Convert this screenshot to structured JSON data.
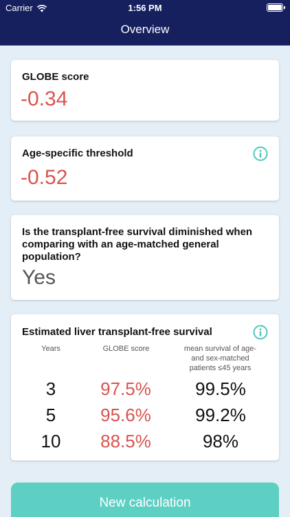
{
  "status_bar": {
    "carrier": "Carrier",
    "time": "1:56 PM"
  },
  "header": {
    "title": "Overview"
  },
  "globe": {
    "label": "GLOBE score",
    "value": "-0.34"
  },
  "threshold": {
    "label": "Age-specific threshold",
    "value": "-0.52",
    "info_icon": "info-icon"
  },
  "comparison": {
    "question": "Is the transplant-free survival diminished when comparing with an age-matched general population?",
    "answer": "Yes"
  },
  "survival": {
    "title": "Estimated liver transplant-free survival",
    "info_icon": "info-icon",
    "headers": {
      "years": "Years",
      "globe": "GLOBE score",
      "mean": "mean survival of age- and sex-matched patients ≤45 years"
    },
    "rows": [
      {
        "years": "3",
        "globe": "97.5%",
        "mean": "99.5%"
      },
      {
        "years": "5",
        "globe": "95.6%",
        "mean": "99.2%"
      },
      {
        "years": "10",
        "globe": "88.5%",
        "mean": "98%"
      }
    ]
  },
  "actions": {
    "new_calculation": "New calculation"
  },
  "colors": {
    "header": "#16205f",
    "accent_red": "#d9534f",
    "teal": "#5ecfc3",
    "background": "#e4eef7"
  }
}
